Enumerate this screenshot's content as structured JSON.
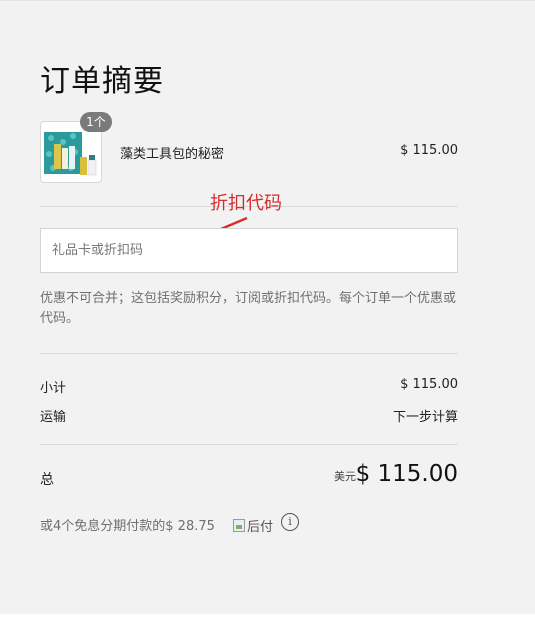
{
  "summary": {
    "title": "订单摘要"
  },
  "product": {
    "quantity_badge": "1个",
    "name": "藻类工具包的秘密",
    "price": "$ 115.00",
    "thumbnail_icon": "product-gift-set-icon"
  },
  "annotation": {
    "label": "折扣代码",
    "color": "#d62d2d"
  },
  "discount": {
    "placeholder": "礼品卡或折扣码",
    "value": "",
    "note": "优惠不可合并；这包括奖励积分，订阅或折扣代码。每个订单一个优惠或代码。"
  },
  "totals": {
    "subtotal_label": "小计",
    "subtotal_value": "$ 115.00",
    "shipping_label": "运输",
    "shipping_value": "下一步计算",
    "total_label": "总",
    "currency": "美元",
    "total_value": "$ 115.00"
  },
  "installment": {
    "text": "或4个免息分期付款的$ 28.75",
    "provider_alt": "后付",
    "info_glyph": "i"
  }
}
